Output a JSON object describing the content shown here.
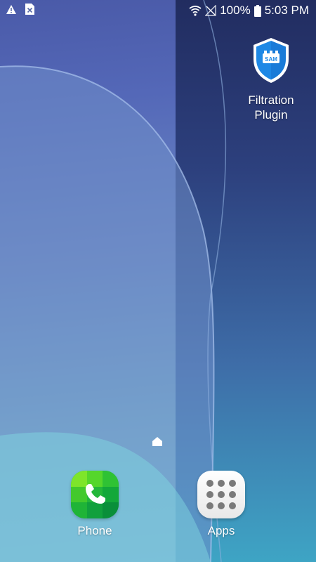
{
  "status_bar": {
    "left_icons": [
      "warning-icon",
      "sim-error-icon"
    ],
    "battery_text": "100%",
    "time": "5:03 PM",
    "right_icons": [
      "wifi-icon",
      "no-signal-icon",
      "battery-icon"
    ]
  },
  "desktop": {
    "shortcut": {
      "label_line1": "Filtration",
      "label_line2": "Plugin",
      "icon": "shield-sam-icon",
      "badge_text": "SAM"
    }
  },
  "dock": {
    "phone": {
      "label": "Phone",
      "icon": "phone-icon"
    },
    "apps": {
      "label": "Apps",
      "icon": "apps-grid-icon"
    }
  },
  "colors": {
    "phone_green": "#17b93e",
    "shield_blue": "#1e88e5",
    "apps_dots": "#7a7a7a"
  }
}
